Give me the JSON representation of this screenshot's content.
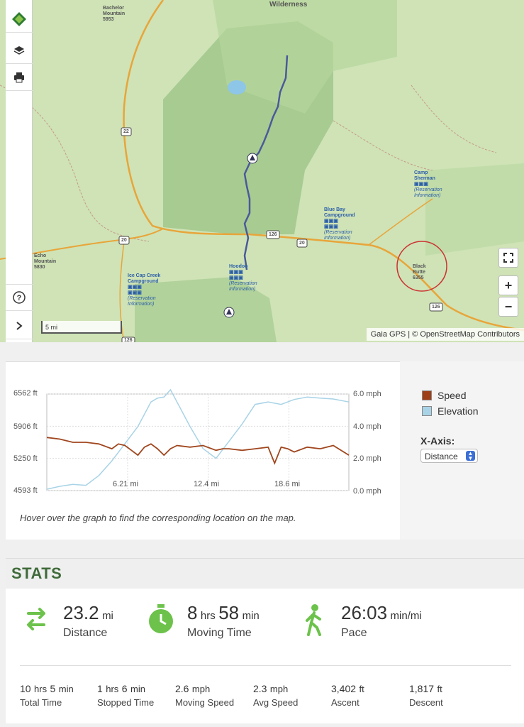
{
  "map": {
    "attribution": "Gaia GPS | © OpenStreetMap Contributors",
    "scale_label": "5 mi",
    "labels": {
      "wilderness": "Wilderness",
      "bachelor_name": "Bachelor Mountain",
      "bachelor_elev": "5953",
      "echo_name": "Echo Mountain",
      "echo_elev": "5830",
      "camp_sherman": "Camp Sherman",
      "blue_bay": "Blue Bay Campground",
      "hoodoo": "Hoodoo",
      "ice_cap": "Ice Cap Creek Campground",
      "black_butte_name": "Black Butte",
      "black_butte_elev": "6355",
      "reservation": "(Reservation Information)",
      "hwy_22": "22",
      "hwy_20a": "20",
      "hwy_20b": "20",
      "hwy_126a": "126",
      "hwy_126b": "126",
      "hwy_126c": "126"
    },
    "toolbar_icons": [
      "gaia-logo-icon",
      "layers-icon",
      "print-icon",
      "help-icon",
      "chevron-right-icon"
    ],
    "controls": {
      "fullscreen": "⛶",
      "zoom_in": "+",
      "zoom_out": "−"
    }
  },
  "chart_data": {
    "type": "line",
    "x_axis": {
      "label_values": [
        "6.21 mi",
        "12.4 mi",
        "18.6 mi"
      ]
    },
    "y_left": {
      "ticks": [
        "6562 ft",
        "5906 ft",
        "5250 ft",
        "4593 ft"
      ],
      "range_ft": [
        4593,
        6562
      ]
    },
    "y_right": {
      "ticks": [
        "6.0 mph",
        "4.0 mph",
        "2.0 mph",
        "0.0 mph"
      ],
      "range_mph": [
        0,
        6
      ]
    },
    "x_range_mi": [
      0,
      23.2
    ],
    "series": [
      {
        "name": "Speed",
        "color": "#a0461e",
        "x": [
          0,
          1,
          2,
          3,
          4,
          5,
          5.5,
          6,
          6.5,
          7,
          7.5,
          8,
          8.5,
          9,
          9.5,
          10,
          11,
          12,
          13,
          13.5,
          14,
          15,
          16,
          17,
          17.5,
          18,
          18.5,
          19,
          20,
          21,
          22,
          23.2
        ],
        "values": [
          3.3,
          3.2,
          3.0,
          3.0,
          2.9,
          2.6,
          2.9,
          2.8,
          2.5,
          2.2,
          2.7,
          2.9,
          2.6,
          2.2,
          2.6,
          2.8,
          2.7,
          2.8,
          2.5,
          2.6,
          2.6,
          2.5,
          2.6,
          2.7,
          1.7,
          2.7,
          2.6,
          2.4,
          2.7,
          2.6,
          2.8,
          2.2
        ]
      },
      {
        "name": "Elevation",
        "color": "#a8d4e6",
        "x": [
          0,
          1,
          2,
          3,
          4,
          5,
          6,
          7,
          8,
          8.5,
          9,
          9.5,
          10,
          11,
          12,
          13,
          14,
          15,
          16,
          17,
          18,
          19,
          20,
          21,
          22,
          23.2
        ],
        "values": [
          4620,
          4680,
          4720,
          4700,
          4900,
          5200,
          5550,
          5900,
          6400,
          6480,
          6500,
          6650,
          6400,
          5900,
          5450,
          5250,
          5600,
          5950,
          6350,
          6400,
          6350,
          6450,
          6500,
          6480,
          6460,
          6400
        ]
      }
    ],
    "legend": "right",
    "grid": true
  },
  "chart_panel": {
    "legend": [
      {
        "label": "Speed",
        "color": "#9e3f17"
      },
      {
        "label": "Elevation",
        "color": "#a8d3e6"
      }
    ],
    "xaxis_title": "X-Axis:",
    "xaxis_value": "Distance",
    "hint": "Hover over the graph to find the corresponding location on the map."
  },
  "stats": {
    "title": "STATS",
    "big": [
      {
        "value": "23.2",
        "unit": "mi",
        "label": "Distance",
        "icon": "loop-arrows-icon"
      },
      {
        "value": "8",
        "unit1": "hrs",
        "value2": "58",
        "unit2": "min",
        "label": "Moving Time",
        "icon": "stopwatch-icon"
      },
      {
        "value": "26:03",
        "unit": "min/mi",
        "label": "Pace",
        "icon": "hiker-icon"
      }
    ],
    "small": [
      {
        "value": "10",
        "unit": "hrs",
        "value2": "5",
        "unit2": "min",
        "label": "Total Time"
      },
      {
        "value": "1",
        "unit": "hrs",
        "value2": "6",
        "unit2": "min",
        "label": "Stopped Time"
      },
      {
        "value": "2.6",
        "unit": "mph",
        "label": "Moving Speed"
      },
      {
        "value": "2.3",
        "unit": "mph",
        "label": "Avg Speed"
      },
      {
        "value": "3,402",
        "unit": "ft",
        "label": "Ascent"
      },
      {
        "value": "1,817",
        "unit": "ft",
        "label": "Descent"
      }
    ]
  }
}
